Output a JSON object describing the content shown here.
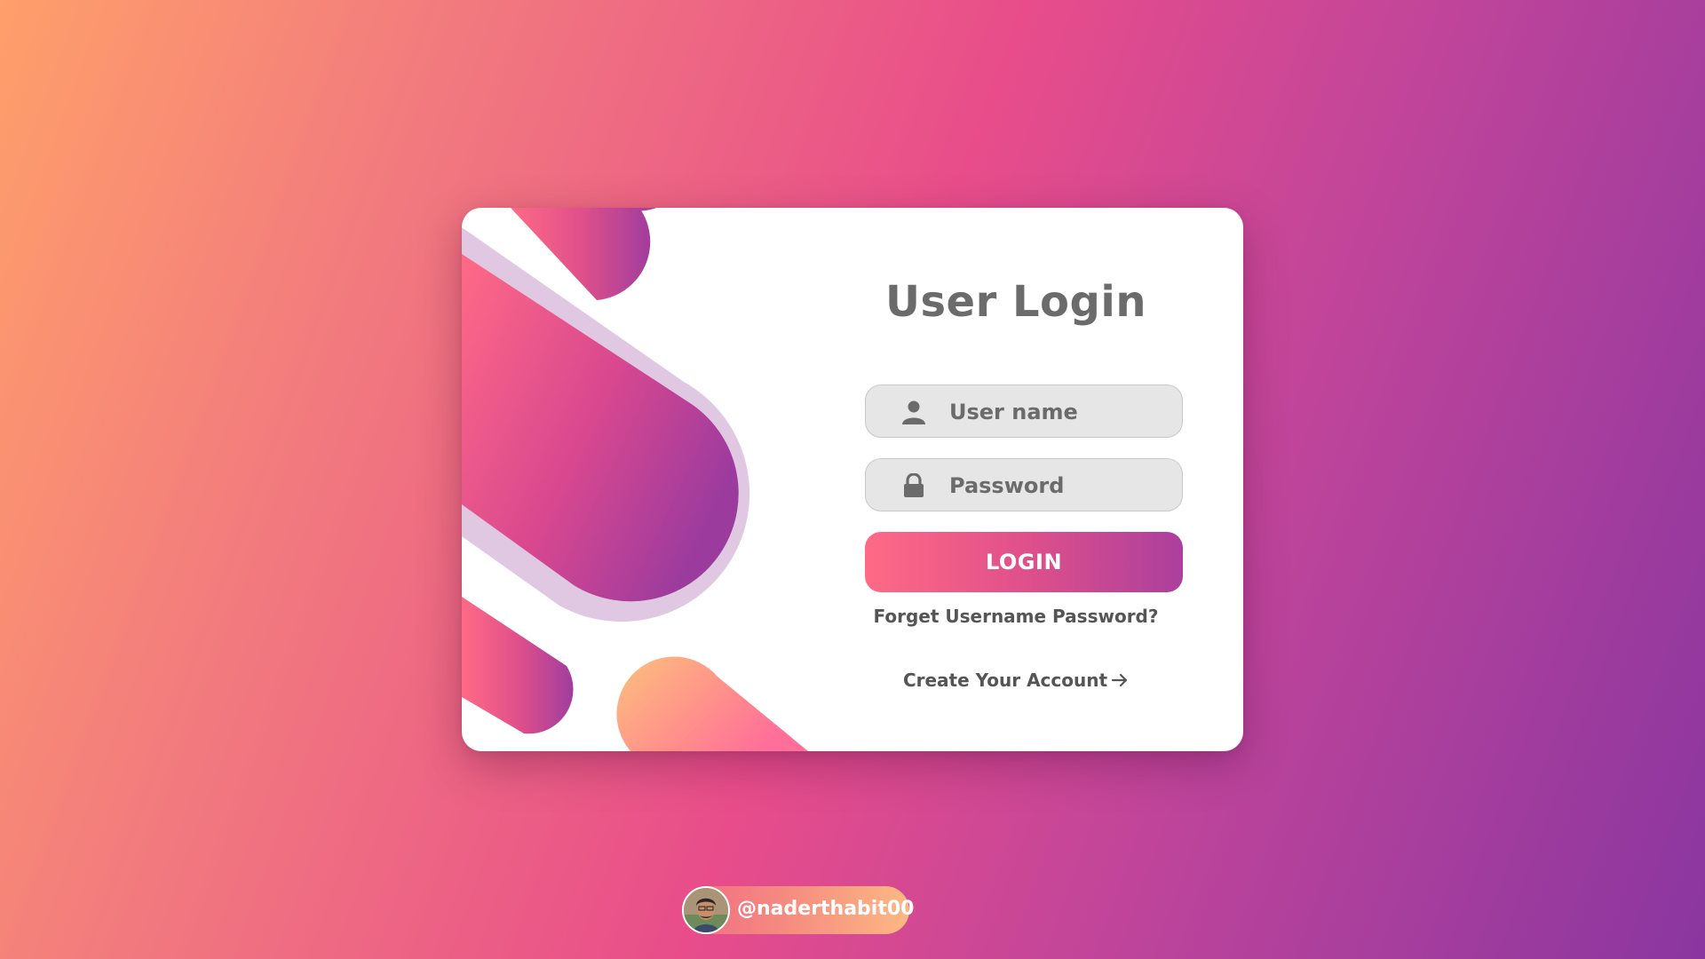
{
  "login_card": {
    "title": "User Login",
    "username_field": {
      "placeholder": "User name",
      "value": "",
      "icon": "user-icon"
    },
    "password_field": {
      "placeholder": "Password",
      "value": "",
      "icon": "lock-icon"
    },
    "login_button_label": "LOGIN",
    "forget_link": "Forget Username Password?",
    "create_account_link": "Create Your Account",
    "create_account_icon": "arrow-right-icon"
  },
  "footer": {
    "handle": "@naderthabit00",
    "avatar_icon": "avatar"
  },
  "colors": {
    "background_start": "#ff9f6a",
    "background_mid": "#e84d8a",
    "background_end": "#8a36a0",
    "accent_pink": "#ff6a86",
    "accent_purple": "#ab3f9d",
    "ring_lavender": "#e0c8e3",
    "text_gray": "#6b6b6b",
    "field_bg": "#e6e6e6"
  }
}
